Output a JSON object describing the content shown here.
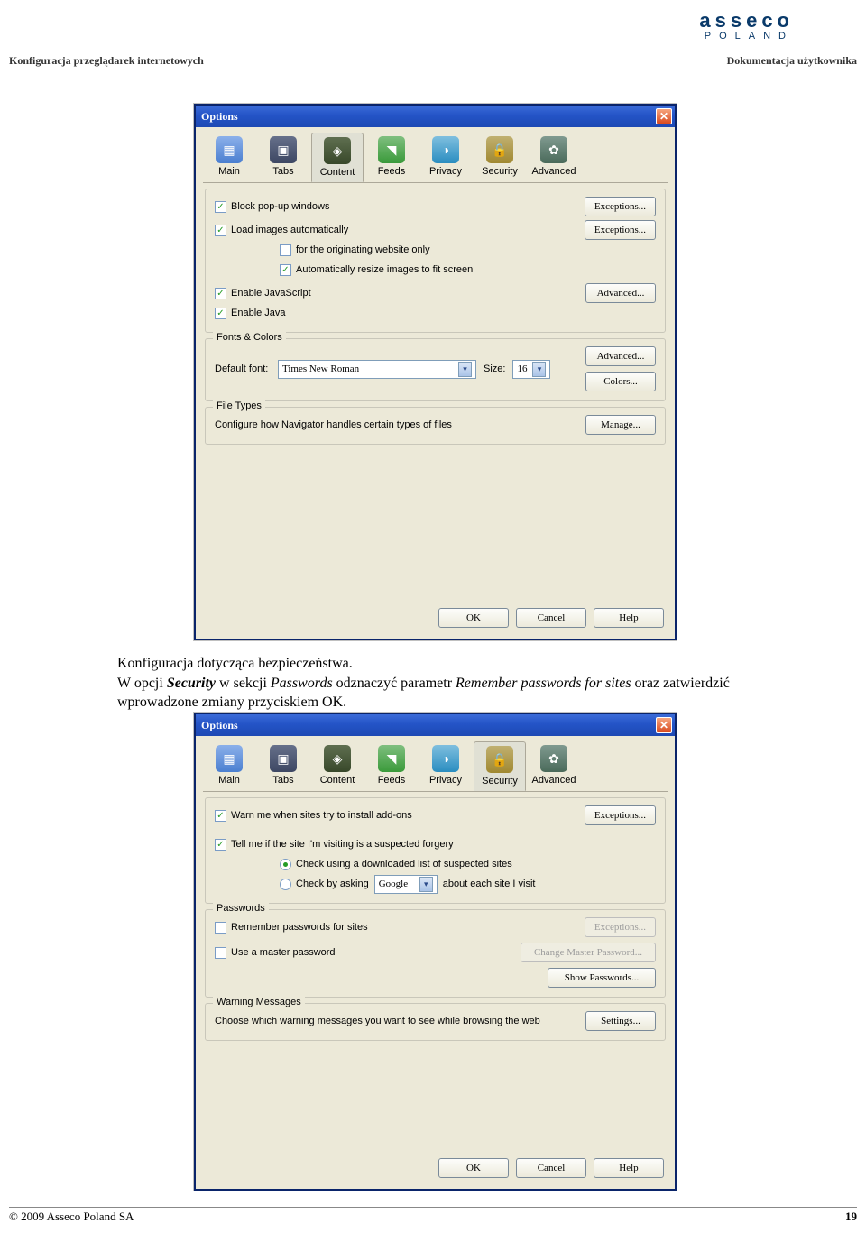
{
  "page": {
    "header_left": "Konfiguracja przeglądarek internetowych",
    "header_right": "Dokumentacja użytkownika",
    "footer_left": "© 2009 Asseco Poland SA",
    "page_number": "19",
    "logo_top": "asseco",
    "logo_sub": "POLAND"
  },
  "body": {
    "line1": "Konfiguracja dotycząca bezpieczeństwa.",
    "line2a": "W opcji ",
    "line2b_bi": "Security",
    "line2c": " w sekcji ",
    "line2d_i": "Passwords",
    "line2e": " odznaczyć parametr ",
    "line2f_i": "Remember passwords for sites",
    "line2g": " oraz zatwierdzić wprowadzone zmiany przyciskiem OK."
  },
  "tabs": [
    "Main",
    "Tabs",
    "Content",
    "Feeds",
    "Privacy",
    "Security",
    "Advanced"
  ],
  "dlg1": {
    "title": "Options",
    "selected_tab": "Content",
    "cb_block": "Block pop-up windows",
    "cb_loadimg": "Load images automatically",
    "cb_orig": "for the originating website only",
    "cb_resize": "Automatically resize images to fit screen",
    "cb_js": "Enable JavaScript",
    "cb_java": "Enable Java",
    "btn_exceptions": "Exceptions...",
    "btn_advanced": "Advanced...",
    "grp_fonts": "Fonts & Colors",
    "lbl_deffont": "Default font:",
    "font_value": "Times New Roman",
    "lbl_size": "Size:",
    "size_value": "16",
    "btn_colors": "Colors...",
    "grp_filetypes": "File Types",
    "lbl_filetypes": "Configure how Navigator handles certain types of files",
    "btn_manage": "Manage...",
    "btn_ok": "OK",
    "btn_cancel": "Cancel",
    "btn_help": "Help"
  },
  "dlg2": {
    "title": "Options",
    "selected_tab": "Security",
    "cb_warn": "Warn me when sites try to install add-ons",
    "cb_tell": "Tell me if the site I'm visiting is a suspected forgery",
    "rb_dl": "Check using a downloaded list of suspected sites",
    "rb_ask": "Check by asking",
    "ask_value": "Google",
    "rb_ask_tail": "about each site I visit",
    "btn_exceptions": "Exceptions...",
    "grp_passwords": "Passwords",
    "cb_remember": "Remember passwords for sites",
    "cb_master": "Use a master password",
    "btn_change_master": "Change Master Password...",
    "btn_show_pw": "Show Passwords...",
    "grp_warn": "Warning Messages",
    "lbl_warn": "Choose which warning messages you want to see while browsing the web",
    "btn_settings": "Settings...",
    "btn_ok": "OK",
    "btn_cancel": "Cancel",
    "btn_help": "Help"
  }
}
